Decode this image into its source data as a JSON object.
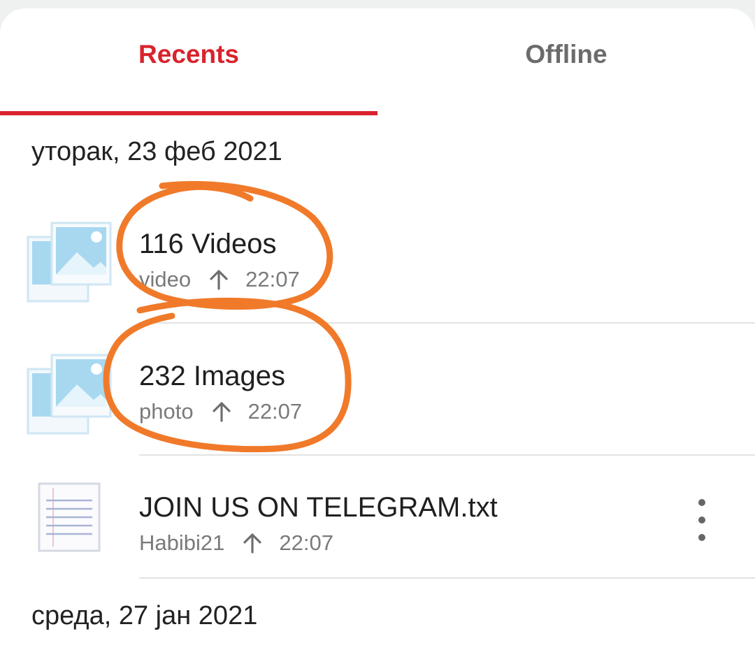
{
  "tabs": [
    {
      "label": "Recents",
      "active": true
    },
    {
      "label": "Offline",
      "active": false
    }
  ],
  "sections": [
    {
      "date": "уторак, 23 феб 2021",
      "items": [
        {
          "title": "116 Videos",
          "source": "video",
          "time": "22:07",
          "icon": "image-stack-icon",
          "upload": "arrow-up-icon"
        },
        {
          "title": "232 Images",
          "source": "photo",
          "time": "22:07",
          "icon": "image-stack-icon",
          "upload": "arrow-up-icon"
        },
        {
          "title": "JOIN US ON TELEGRAM.txt",
          "source": "Habibi21",
          "time": "22:07",
          "icon": "text-file-icon",
          "upload": "arrow-up-icon",
          "menu": "more-vert-icon"
        }
      ]
    },
    {
      "date": "среда, 27 јан 2021"
    }
  ],
  "colors": {
    "accent": "#d9232d",
    "annotation": "#f07a2a",
    "thumbnail": "#a8d8f0"
  }
}
